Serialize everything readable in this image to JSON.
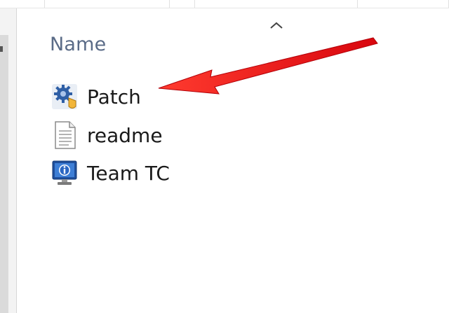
{
  "column_header": {
    "name_label": "Name",
    "sort_icon": "chevron-up-icon"
  },
  "files": [
    {
      "label": "Patch",
      "icon": "gear-installer-icon"
    },
    {
      "label": "readme",
      "icon": "text-document-icon"
    },
    {
      "label": "Team TC",
      "icon": "computer-info-icon"
    }
  ],
  "annotation": {
    "arrow_color": "#e8141a"
  },
  "colors": {
    "header_text": "#5a6b87",
    "file_text": "#1a1a1a"
  }
}
